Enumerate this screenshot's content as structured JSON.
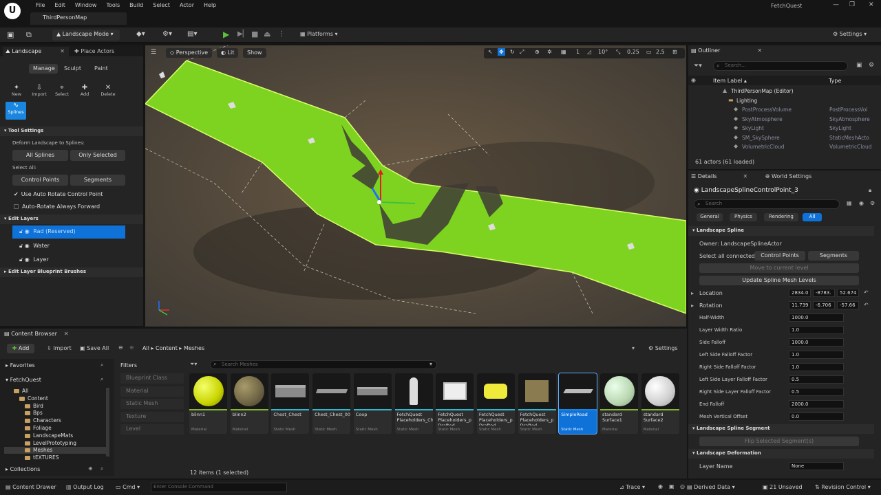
{
  "title_bar": {
    "logo": "U",
    "menu": [
      "File",
      "Edit",
      "Window",
      "Tools",
      "Build",
      "Select",
      "Actor",
      "Help"
    ],
    "map_tab": "ThirdPersonMap",
    "project_title": "FetchQuest"
  },
  "toolbar": {
    "mode": "Landscape Mode",
    "platforms": "Platforms",
    "settings": "Settings"
  },
  "landscape_panel": {
    "tabs": [
      "Landscape",
      "Place Actors"
    ],
    "modes": [
      "Manage",
      "Sculpt",
      "Paint"
    ],
    "tools": [
      "New",
      "Import",
      "Select",
      "Add",
      "Delete",
      "Splines"
    ],
    "tool_settings": "Tool Settings",
    "deform_label": "Deform Landscape to Splines:",
    "deform_buttons": [
      "All Splines",
      "Only Selected"
    ],
    "select_all": "Select All:",
    "select_buttons": [
      "Control Points",
      "Segments"
    ],
    "checkboxes": [
      "Use Auto Rotate Control Point",
      "Auto-Rotate Always Forward"
    ],
    "edit_layers": "Edit Layers",
    "layers": [
      "Rad (Reserved)",
      "Water",
      "Layer"
    ],
    "blueprint_brushes": "Edit Layer Blueprint Brushes"
  },
  "viewport": {
    "perspective": "Perspective",
    "lit": "Lit",
    "show": "Show",
    "grid_val": "1",
    "angle_val": "10°",
    "scale_val": "0.25",
    "cam_speed": "2.5"
  },
  "outliner": {
    "title": "Outliner",
    "search": "Search...",
    "col_label": "Item Label ▴",
    "col_type": "Type",
    "rows": [
      {
        "label": "ThirdPersonMap (Editor)",
        "type": ""
      },
      {
        "label": "Lighting",
        "type": ""
      },
      {
        "label": "PostProcessVolume",
        "type": "PostProcessVol"
      },
      {
        "label": "SkyAtmosphere",
        "type": "SkyAtmosphere"
      },
      {
        "label": "SkyLight",
        "type": "SkyLight"
      },
      {
        "label": "SM_SkySphere",
        "type": "StaticMeshActo"
      },
      {
        "label": "VolumetricCloud",
        "type": "VolumetricCloud"
      }
    ],
    "count": "61 actors (61 loaded)"
  },
  "details": {
    "tabs": [
      "Details",
      "World Settings"
    ],
    "object": "LandscapeSplineControlPoint_3",
    "search": "Search",
    "filters": [
      "General",
      "Physics",
      "Rendering",
      "All"
    ],
    "section1": "Landscape Spline",
    "owner": "Owner: LandscapeSplineActor",
    "select_connected": "Select all connected",
    "sel_buttons": [
      "Control Points",
      "Segments"
    ],
    "move_btn": "Move to current level",
    "update_btn": "Update Spline Mesh Levels",
    "location": {
      "label": "Location",
      "x": "2834.0",
      "y": "-8783.",
      "z": "52.674"
    },
    "rotation": {
      "label": "Rotation",
      "x": "11.739",
      "y": "-6.706",
      "z": "-57.66"
    },
    "props": [
      {
        "label": "Half-Width",
        "value": "1000.0"
      },
      {
        "label": "Layer Width Ratio",
        "value": "1.0"
      },
      {
        "label": "Side Falloff",
        "value": "1000.0"
      },
      {
        "label": "Left Side Falloff Factor",
        "value": "1.0"
      },
      {
        "label": "Right Side Falloff Factor",
        "value": "1.0"
      },
      {
        "label": "Left Side Layer Falloff Factor",
        "value": "0.5"
      },
      {
        "label": "Right Side Layer Falloff Factor",
        "value": "0.5"
      },
      {
        "label": "End Falloff",
        "value": "2000.0"
      },
      {
        "label": "Mesh Vertical Offset",
        "value": "0.0"
      }
    ],
    "section2": "Landscape Spline Segment",
    "flip_btn": "Flip Selected Segment(s)",
    "section3": "Landscape Deformation",
    "layer_name": {
      "label": "Layer Name",
      "value": "None"
    }
  },
  "content_browser": {
    "title": "Content Browser",
    "add": "Add",
    "import": "Import",
    "save_all": "Save All",
    "path": [
      "All",
      "Content",
      "Meshes"
    ],
    "settings": "Settings",
    "favorites": "Favorites",
    "project": "FetchQuest",
    "tree": [
      "All",
      "Content",
      "Bird",
      "Bps",
      "Characters",
      "Foliage",
      "LandscapeMats",
      "LevelPrototyping",
      "Meshes",
      "tEXTURES"
    ],
    "collections": "Collections",
    "filters_title": "Filters",
    "filters": [
      "Blueprint Class",
      "Material",
      "Static Mesh",
      "Texture",
      "Level"
    ],
    "search": "Search Meshes",
    "assets": [
      {
        "name": "blinn1",
        "type": "Material"
      },
      {
        "name": "blinn2",
        "type": "Material"
      },
      {
        "name": "Chest_Chest",
        "type": "Static Mesh"
      },
      {
        "name": "Chest_Chest_001",
        "type": "Static Mesh"
      },
      {
        "name": "Coop",
        "type": "Static Mesh"
      },
      {
        "name": "FetchQuest Placeholders_Chara...",
        "type": "Static Mesh"
      },
      {
        "name": "FetchQuest Placeholders_p Drafted",
        "type": "Static Mesh"
      },
      {
        "name": "FetchQuest Placeholders_p Drafted",
        "type": "Static Mesh"
      },
      {
        "name": "FetchQuest Placeholders_p Drafted",
        "type": "Static Mesh"
      },
      {
        "name": "SimpleRoad",
        "type": "Static Mesh"
      },
      {
        "name": "standard Surface1",
        "type": "Material"
      },
      {
        "name": "standard Surface2",
        "type": "Material"
      }
    ],
    "count": "12 items (1 selected)"
  },
  "status_bar": {
    "content_drawer": "Content Drawer",
    "output_log": "Output Log",
    "cmd": "Cmd",
    "console_placeholder": "Enter Console Command",
    "trace": "Trace",
    "derived_data": "Derived Data",
    "unsaved": "21 Unsaved",
    "revision": "Revision Control"
  },
  "colors": {
    "accent": "#0e72d8",
    "landscape_green": "#7ed321",
    "selection": "#1a86e0"
  }
}
